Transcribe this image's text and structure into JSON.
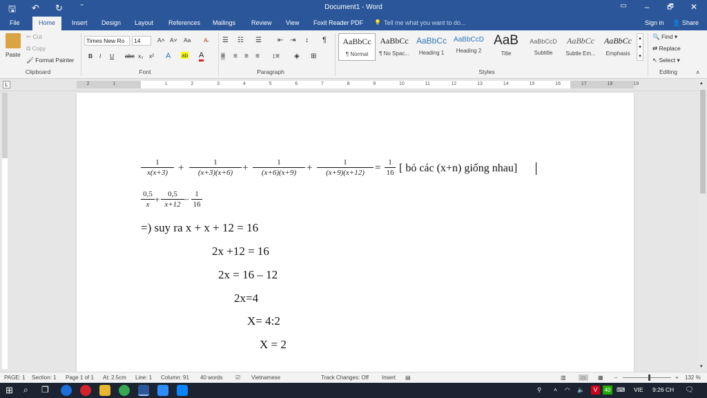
{
  "window": {
    "title": "Document1 - Word",
    "minimize": "–",
    "maximize": "🗗",
    "close": "✕"
  },
  "qat": {
    "save": "🖫",
    "undo": "↶",
    "redo": "↻",
    "customize": "⁼"
  },
  "tabs": [
    {
      "label": "File"
    },
    {
      "label": "Home"
    },
    {
      "label": "Insert"
    },
    {
      "label": "Design"
    },
    {
      "label": "Layout"
    },
    {
      "label": "References"
    },
    {
      "label": "Mailings"
    },
    {
      "label": "Review"
    },
    {
      "label": "View"
    },
    {
      "label": "Foxit Reader PDF"
    }
  ],
  "tell_me": "Tell me what you want to do...",
  "sign_in": "Sign in",
  "share": "Share",
  "clipboard": {
    "paste": "Paste",
    "cut": "Cut",
    "copy": "Copy",
    "format_painter": "Format Painter",
    "label": "Clipboard"
  },
  "font": {
    "name": "Times New Ro",
    "size": "14",
    "label": "Font",
    "bold": "B",
    "italic": "I",
    "underline": "U",
    "strike": "abc",
    "sub": "x₂",
    "sup": "x²",
    "grow": "A˄",
    "shrink": "A˅",
    "case": "Aa",
    "clear": "A̶",
    "effects": "A",
    "highlight": "ab",
    "color": "A"
  },
  "paragraph": {
    "label": "Paragraph",
    "marks": "¶"
  },
  "styles": {
    "label": "Styles",
    "items": [
      {
        "preview": "AaBbCc",
        "name": "¶ Normal"
      },
      {
        "preview": "AaBbCc",
        "name": "¶ No Spac..."
      },
      {
        "preview": "AaBbCc",
        "name": "Heading 1"
      },
      {
        "preview": "AaBbCcD",
        "name": "Heading 2"
      },
      {
        "preview": "AaB",
        "name": "Title"
      },
      {
        "preview": "AaBbCcD",
        "name": "Subtitle"
      },
      {
        "preview": "AaBbCc",
        "name": "Subtle Em..."
      },
      {
        "preview": "AaBbCc",
        "name": "Emphasis"
      }
    ]
  },
  "editing": {
    "label": "Editing",
    "find": "Find",
    "replace": "Replace",
    "select": "Select"
  },
  "ruler": {
    "numbers": [
      "2",
      "1",
      "1",
      "2",
      "3",
      "4",
      "5",
      "6",
      "7",
      "8",
      "9",
      "10",
      "11",
      "12",
      "13",
      "14",
      "15",
      "16",
      "17",
      "18",
      "19"
    ]
  },
  "doc": {
    "eq1": {
      "fractions": [
        {
          "num": "1",
          "den": "x(x+3)"
        },
        {
          "num": "1",
          "den": "(x+3)(x+6)"
        },
        {
          "num": "1",
          "den": "(x+6)(x+9)"
        },
        {
          "num": "1",
          "den": "(x+9)(x+12)"
        },
        {
          "num": "1",
          "den": "16"
        }
      ],
      "plus": "+",
      "equals": "=",
      "note": "[ bỏ các (x+n) giống nhau]"
    },
    "eq2": {
      "fractions": [
        {
          "num": "0,5",
          "den": "x"
        },
        {
          "num": "0,5",
          "den": "x+12"
        },
        {
          "num": "1",
          "den": "16"
        }
      ],
      "plus": "+",
      "minus": "–"
    },
    "lines": [
      "=) suy ra x + x + 12 = 16",
      "2x +12 = 16",
      "2x = 16 – 12",
      "2x=4",
      "X= 4:2",
      "X = 2"
    ]
  },
  "status": {
    "page": "PAGE: 1",
    "section": "Section: 1",
    "page_of": "Page 1 of 1",
    "at": "At: 2.5cm",
    "line": "Line: 1",
    "column": "Column: 91",
    "words": "40 words",
    "language": "Vietnamese",
    "track": "Track Changes: Off",
    "insert": "Insert",
    "zoom": "132 %",
    "zoom_minus": "–",
    "zoom_plus": "+"
  },
  "tray": {
    "lang": "VIE",
    "time": "9:26 CH",
    "badge": "40"
  },
  "colors": {
    "word_blue": "#2b579a",
    "taskbar": "#1b2430"
  }
}
